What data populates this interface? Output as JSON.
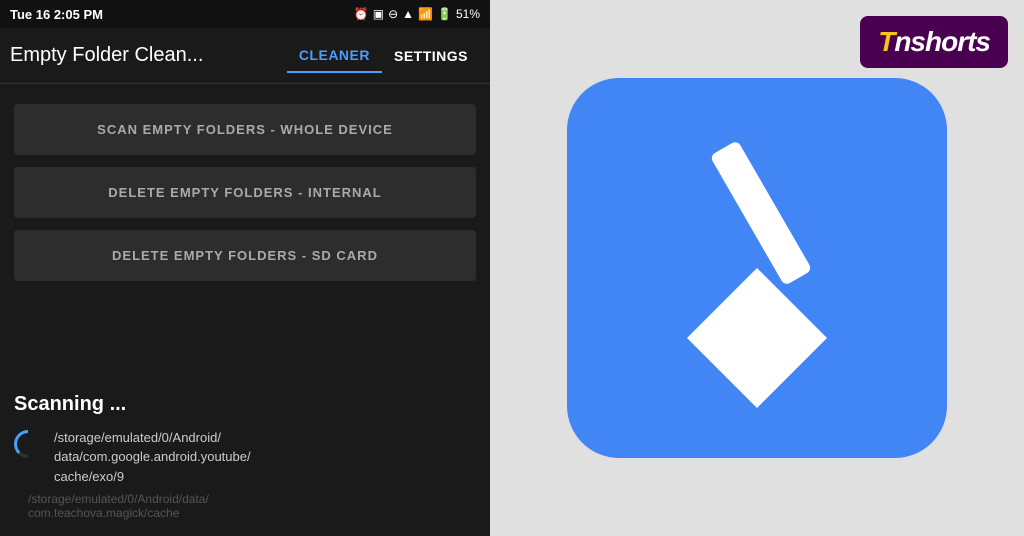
{
  "statusBar": {
    "time": "Tue 16  2:05 PM",
    "batteryPercent": "51%",
    "icons": "alarm clock battery"
  },
  "navBar": {
    "title": "Empty Folder Clean...",
    "tabs": [
      {
        "label": "CLEANER",
        "active": true
      },
      {
        "label": "SETTINGS",
        "active": false
      }
    ]
  },
  "buttons": [
    {
      "label": "SCAN EMPTY FOLDERS - WHOLE DEVICE"
    },
    {
      "label": "DELETE EMPTY FOLDERS - INTERNAL"
    },
    {
      "label": "DELETE EMPTY FOLDERS - SD CARD"
    }
  ],
  "scanning": {
    "title": "Scanning ...",
    "currentPath": "/storage/emulated/0/Android/\ndata/com.google.android.youtube/\ncache/exo/9",
    "previousPath": "/storage/emulated/0/Android/data/\ncom.teachova.magick/cache"
  },
  "inshorts": {
    "brand": "Inshorts",
    "displayText": "Tnshorts"
  },
  "appIcon": {
    "bgColor": "#4285f4",
    "shape": "rounded-square"
  }
}
